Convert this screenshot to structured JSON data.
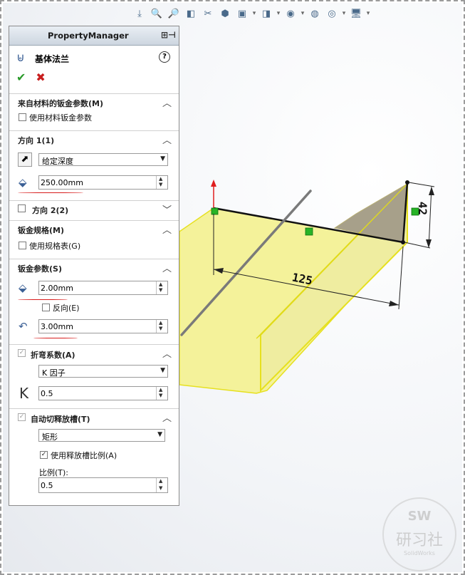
{
  "property_manager": {
    "header_title": "PropertyManager",
    "feature_title": "基体法兰",
    "help_glyph": "?",
    "ok_glyph": "✔",
    "cancel_glyph": "✖"
  },
  "sections": {
    "material_params": {
      "title": "来自材料的钣金参数(M)",
      "use_material_label": "使用材料钣金参数",
      "use_material_checked": false
    },
    "direction1": {
      "title": "方向 1(1)",
      "end_condition": "给定深度",
      "depth_value": "250.00mm"
    },
    "direction2": {
      "title": "方向 2(2)",
      "checked": false
    },
    "gauge": {
      "title": "钣金规格(M)",
      "use_gauge_label": "使用规格表(G)",
      "checked": false
    },
    "sheet_params": {
      "title": "钣金参数(S)",
      "thickness_value": "2.00mm",
      "reverse_label": "反向(E)",
      "reverse_checked": false,
      "radius_value": "3.00mm"
    },
    "bend_allowance": {
      "title": "折弯系数(A)",
      "checked": true,
      "type": "K 因子",
      "k_symbol": "K",
      "k_value": "0.5"
    },
    "auto_relief": {
      "title": "自动切释放槽(T)",
      "checked": true,
      "type": "矩形",
      "use_ratio_label": "使用释放槽比例(A)",
      "use_ratio_checked": true,
      "ratio_label": "比例(T):",
      "ratio_value": "0.5"
    }
  },
  "graphics": {
    "dimension_length": "125",
    "dimension_height": "42"
  },
  "watermark": {
    "line1": "SW",
    "line2": "研习社",
    "line3": "SolidWorks"
  },
  "colors": {
    "flange_fill": "#f4f29a",
    "flange_edge": "#e6e01e",
    "accent_green": "#2a9a2a",
    "accent_red": "#c81e1e"
  }
}
